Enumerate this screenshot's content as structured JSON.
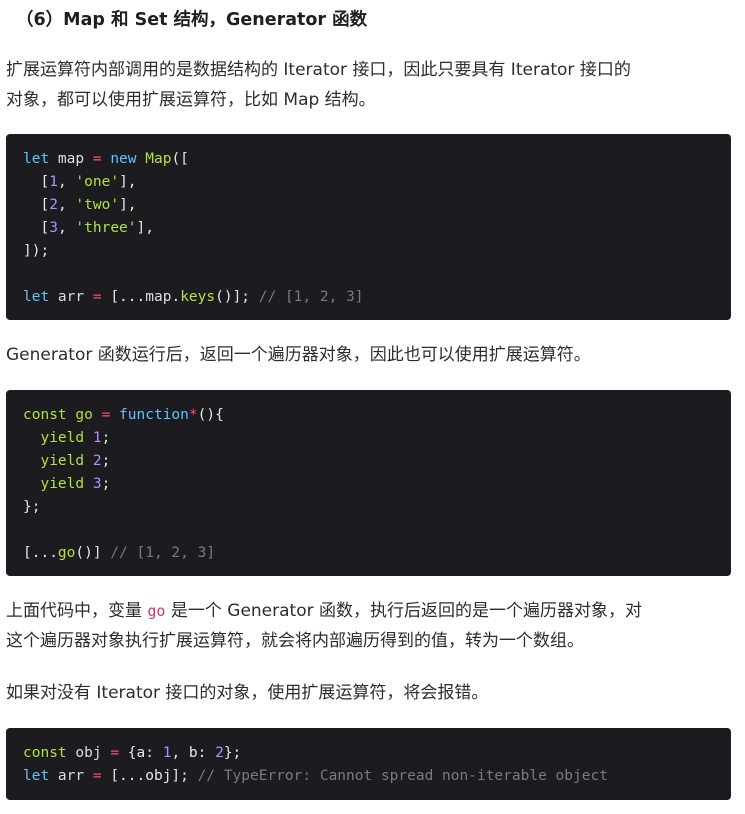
{
  "heading": "（6）Map 和 Set 结构，Generator 函数",
  "para1": {
    "line1": "扩展运算符内部调用的是数据结构的 Iterator 接口，因此只要具有 Iterator 接口的",
    "line2": "对象，都可以使用扩展运算符，比如 Map 结构。"
  },
  "code1": {
    "l1": {
      "kw": "let",
      "id": " map ",
      "op": "=",
      "kw2": " new ",
      "fn": "Map",
      "pl": "(["
    },
    "l2": {
      "pre": "  [",
      "num": "1",
      "mid": ", ",
      "str": "'one'",
      "post": "],"
    },
    "l3": {
      "pre": "  [",
      "num": "2",
      "mid": ", ",
      "str": "'two'",
      "post": "],"
    },
    "l4": {
      "pre": "  [",
      "num": "3",
      "mid": ", ",
      "str": "'three'",
      "post": "],"
    },
    "l5": "]);",
    "l7": {
      "kw": "let",
      "id": " arr ",
      "op": "=",
      "pre": " [...",
      "id2": "map",
      "dot": ".",
      "fn": "keys",
      "post": "()]; ",
      "cm": "// [1, 2, 3]"
    }
  },
  "para2": "Generator 函数运行后，返回一个遍历器对象，因此也可以使用扩展运算符。",
  "code2": {
    "l1": {
      "kw": "const",
      "fn": " go ",
      "op": "=",
      "kw2": " function",
      "star": "*",
      "pl": "(){"
    },
    "l2": {
      "kw": "  yield ",
      "num": "1",
      "pl": ";"
    },
    "l3": {
      "kw": "  yield ",
      "num": "2",
      "pl": ";"
    },
    "l4": {
      "kw": "  yield ",
      "num": "3",
      "pl": ";"
    },
    "l5": "};",
    "l7": {
      "pre": "[...",
      "fn": "go",
      "post": "()] ",
      "cm": "// [1, 2, 3]"
    }
  },
  "para3": {
    "line1_a": "上面代码中，变量 ",
    "line1_code": "go",
    "line1_b": " 是一个 Generator 函数，执行后返回的是一个遍历器对象，对",
    "line2": "这个遍历器对象执行扩展运算符，就会将内部遍历得到的值，转为一个数组。"
  },
  "para4": "如果对没有 Iterator 接口的对象，使用扩展运算符，将会报错。",
  "code3": {
    "l1": {
      "kw": "const",
      "id": " obj ",
      "op": "=",
      "pre": " {a: ",
      "num1": "1",
      "mid": ", b: ",
      "num2": "2",
      "post": "};"
    },
    "l2": {
      "kw": "let",
      "id": " arr ",
      "op": "=",
      "pre": " [...obj]; ",
      "cm": "// TypeError: Cannot spread non-iterable object"
    }
  }
}
